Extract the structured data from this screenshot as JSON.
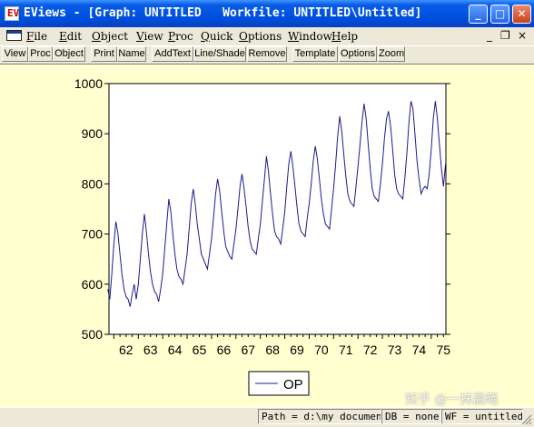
{
  "window": {
    "title": "EViews - [Graph: UNTITLED   Workfile: UNTITLED\\Untitled]",
    "app_icon_text": "EV",
    "controls": {
      "minimize": "_",
      "maximize": "□",
      "close": "✕"
    }
  },
  "menubar": {
    "items": [
      {
        "u": "F",
        "rest": "ile"
      },
      {
        "u": "E",
        "rest": "dit"
      },
      {
        "u": "O",
        "rest": "bject"
      },
      {
        "u": "V",
        "rest": "iew"
      },
      {
        "u": "P",
        "rest": "roc"
      },
      {
        "u": "Q",
        "rest": "uick"
      },
      {
        "u": "O",
        "rest": "ptions"
      },
      {
        "u": "W",
        "rest": "indow"
      },
      {
        "u": "H",
        "rest": "elp"
      }
    ],
    "mdi_controls": {
      "minimize": "_",
      "restore": "❐",
      "close": "×"
    }
  },
  "toolbar": {
    "buttons": [
      "View",
      "Proc",
      "Object",
      "Print",
      "Name",
      "AddText",
      "Line/Shade",
      "Remove",
      "Template",
      "Options",
      "Zoom"
    ]
  },
  "statusbar": {
    "path": "Path = d:\\my documents",
    "db": "DB = none",
    "wf": "WF = untitled"
  },
  "watermark": "知乎 @一抹晨曦",
  "colors": {
    "line": "#1c1c8c",
    "graph_bg": "#ffffd0",
    "title_bar": "#0054e3"
  },
  "chart_data": {
    "type": "line",
    "title": "",
    "xlabel": "",
    "ylabel": "",
    "ylim": [
      500,
      1000
    ],
    "yticks": [
      500,
      600,
      700,
      800,
      900,
      1000
    ],
    "xlim": [
      1961.8,
      1975.6
    ],
    "xticks": [
      "62",
      "63",
      "64",
      "65",
      "66",
      "67",
      "68",
      "69",
      "70",
      "71",
      "72",
      "73",
      "74",
      "75"
    ],
    "grid": false,
    "legend": "bottom-center",
    "frequency": "monthly",
    "start": "1961M10",
    "series": [
      {
        "name": "OP",
        "values": [
          590,
          570,
          620,
          680,
          725,
          700,
          660,
          620,
          590,
          575,
          570,
          555,
          580,
          600,
          570,
          600,
          650,
          700,
          740,
          705,
          660,
          625,
          600,
          585,
          580,
          565,
          590,
          620,
          670,
          720,
          770,
          745,
          700,
          660,
          630,
          615,
          610,
          600,
          630,
          660,
          710,
          760,
          790,
          760,
          720,
          690,
          660,
          650,
          640,
          630,
          660,
          690,
          735,
          780,
          810,
          785,
          745,
          705,
          675,
          665,
          655,
          650,
          680,
          710,
          750,
          795,
          820,
          790,
          755,
          715,
          685,
          670,
          665,
          660,
          690,
          720,
          765,
          810,
          855,
          825,
          780,
          740,
          705,
          695,
          690,
          680,
          710,
          745,
          795,
          840,
          865,
          835,
          795,
          755,
          720,
          705,
          700,
          695,
          730,
          760,
          800,
          845,
          875,
          850,
          810,
          770,
          740,
          720,
          715,
          710,
          750,
          790,
          840,
          895,
          935,
          905,
          860,
          815,
          780,
          765,
          760,
          755,
          795,
          835,
          880,
          925,
          960,
          930,
          880,
          830,
          790,
          775,
          770,
          765,
          800,
          840,
          890,
          930,
          945,
          915,
          870,
          820,
          790,
          780,
          775,
          770,
          810,
          860,
          920,
          965,
          950,
          900,
          845,
          810,
          780,
          790,
          795,
          790,
          820,
          870,
          930,
          965,
          930,
          880,
          830,
          795,
          840
        ]
      }
    ]
  }
}
